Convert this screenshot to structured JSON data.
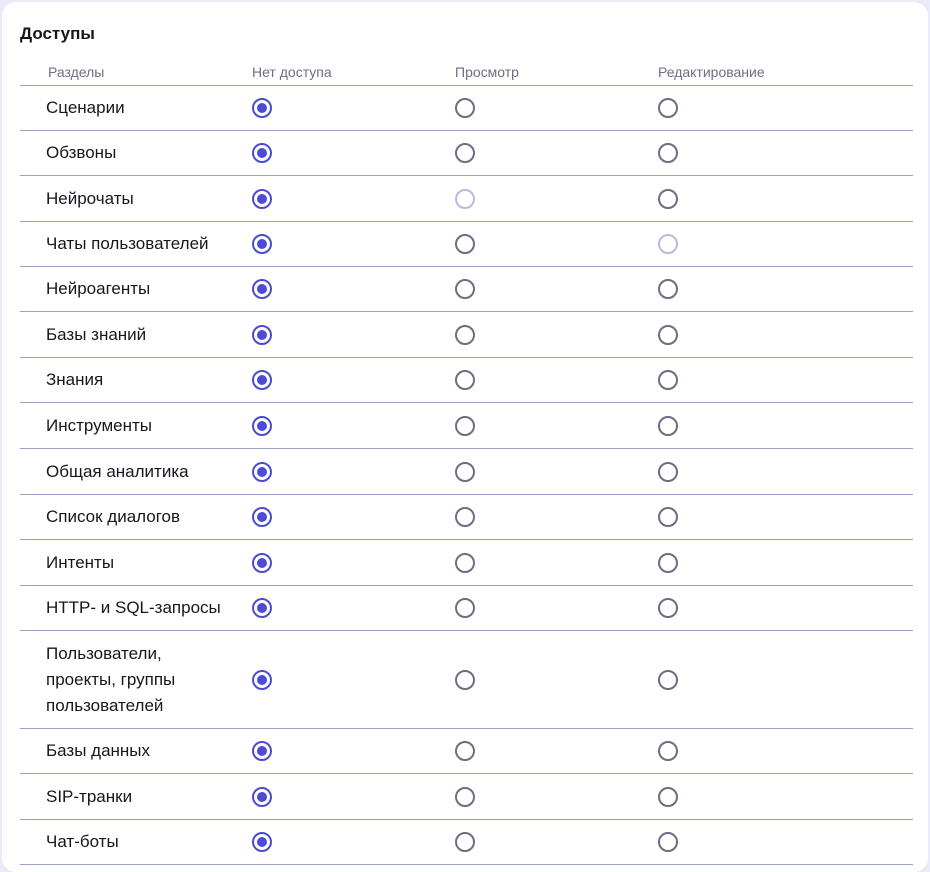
{
  "section": {
    "title": "Доступы"
  },
  "headers": {
    "name": "Разделы",
    "none": "Нет доступа",
    "view": "Просмотр",
    "edit": "Редактирование"
  },
  "rows": [
    {
      "name": "Сценарии",
      "selected": "none"
    },
    {
      "name": "Обзвоны",
      "selected": "none"
    },
    {
      "name": "Нейрочаты",
      "selected": "none",
      "disabled": [
        "view"
      ]
    },
    {
      "name": "Чаты пользователей",
      "selected": "none",
      "disabled": [
        "edit"
      ]
    },
    {
      "name": "Нейроагенты",
      "selected": "none"
    },
    {
      "name": "Базы знаний",
      "selected": "none"
    },
    {
      "name": "Знания",
      "selected": "none"
    },
    {
      "name": "Инструменты",
      "selected": "none"
    },
    {
      "name": "Общая аналитика",
      "selected": "none"
    },
    {
      "name": "Список диалогов",
      "selected": "none"
    },
    {
      "name": "Интенты",
      "selected": "none"
    },
    {
      "name": "HTTP- и SQL-запросы",
      "selected": "none"
    },
    {
      "name": "Пользователи, проекты, группы пользователей",
      "selected": "none"
    },
    {
      "name": "Базы данных",
      "selected": "none"
    },
    {
      "name": "SIP-транки",
      "selected": "none"
    },
    {
      "name": "Чат-боты",
      "selected": "none"
    }
  ],
  "colors": {
    "accent": "#4b4bd6",
    "divider": "#9ea0cc",
    "disabled": "#b9b9e6"
  }
}
